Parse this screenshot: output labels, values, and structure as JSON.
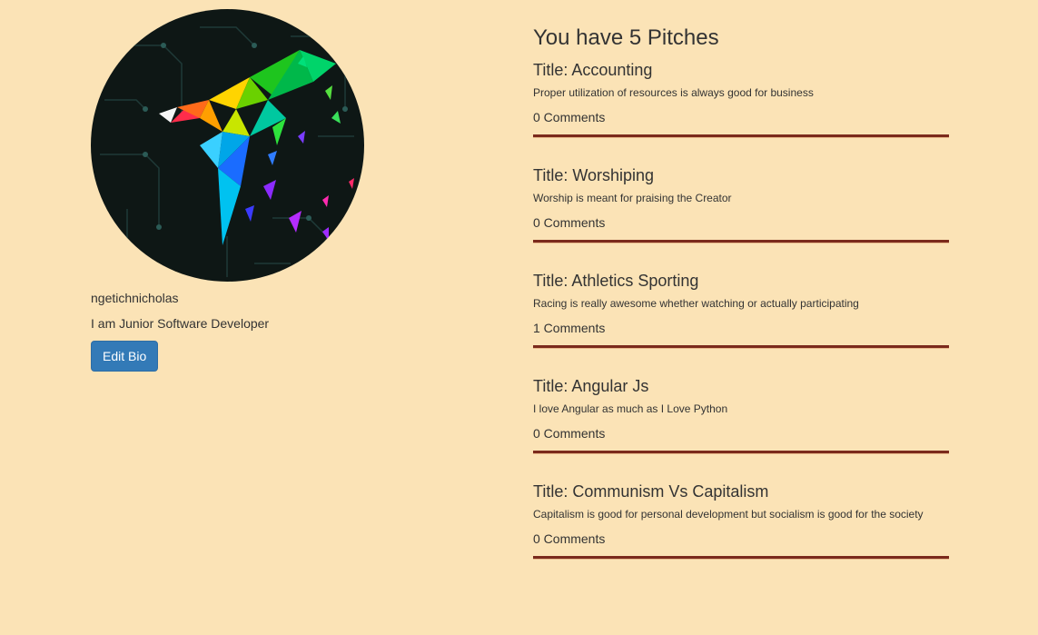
{
  "profile": {
    "username": "ngetichnicholas",
    "bio": "I am Junior Software Developer",
    "edit_label": "Edit Bio",
    "avatar_icon": "parrot-logo-icon"
  },
  "pitches": {
    "heading": "You have 5 Pitches",
    "items": [
      {
        "title": "Title: Accounting",
        "description": "Proper utilization of resources is always good for business",
        "comments": "0 Comments"
      },
      {
        "title": "Title: Worshiping",
        "description": "Worship is meant for praising the Creator",
        "comments": "0 Comments"
      },
      {
        "title": "Title: Athletics Sporting",
        "description": "Racing is really awesome whether watching or actually participating",
        "comments": "1 Comments"
      },
      {
        "title": "Title: Angular Js",
        "description": "I love Angular as much as I Love Python",
        "comments": "0 Comments"
      },
      {
        "title": "Title: Communism Vs Capitalism",
        "description": "Capitalism is good for personal development but socialism is good for the society",
        "comments": "0 Comments"
      }
    ]
  },
  "colors": {
    "page_background": "#fbe3b6",
    "divider": "#7b2a1c",
    "button": "#337ab7",
    "text": "#333333"
  }
}
